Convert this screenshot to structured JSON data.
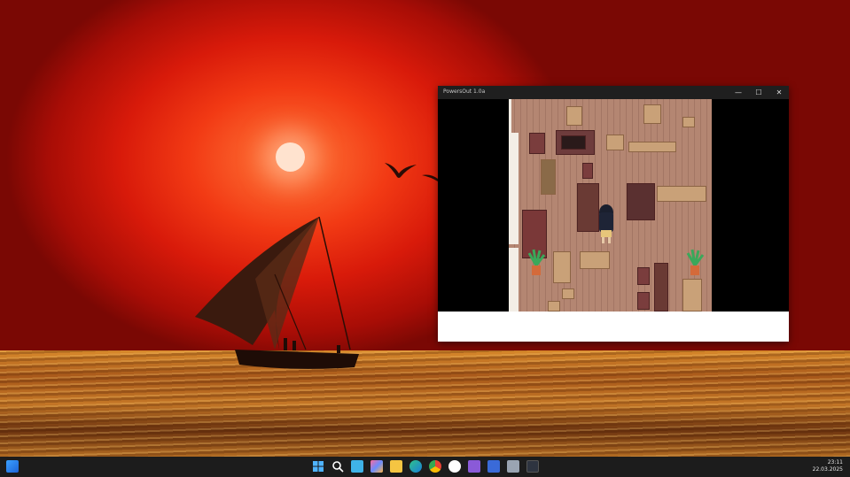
{
  "window": {
    "title": "PowersOut 1.0a",
    "minimize_glyph": "—",
    "maximize_glyph": "☐",
    "close_glyph": "✕"
  },
  "taskbar": {
    "icons": [
      "widgets-icon",
      "start-icon",
      "search-icon",
      "notepad-icon",
      "copilot-icon",
      "file-explorer-icon",
      "edge-icon",
      "chrome-icon",
      "yandex-icon",
      "visual-studio-icon",
      "save-icon",
      "printer-icon",
      "game-icon"
    ],
    "time": "23:11",
    "date": "22.03.2025"
  }
}
